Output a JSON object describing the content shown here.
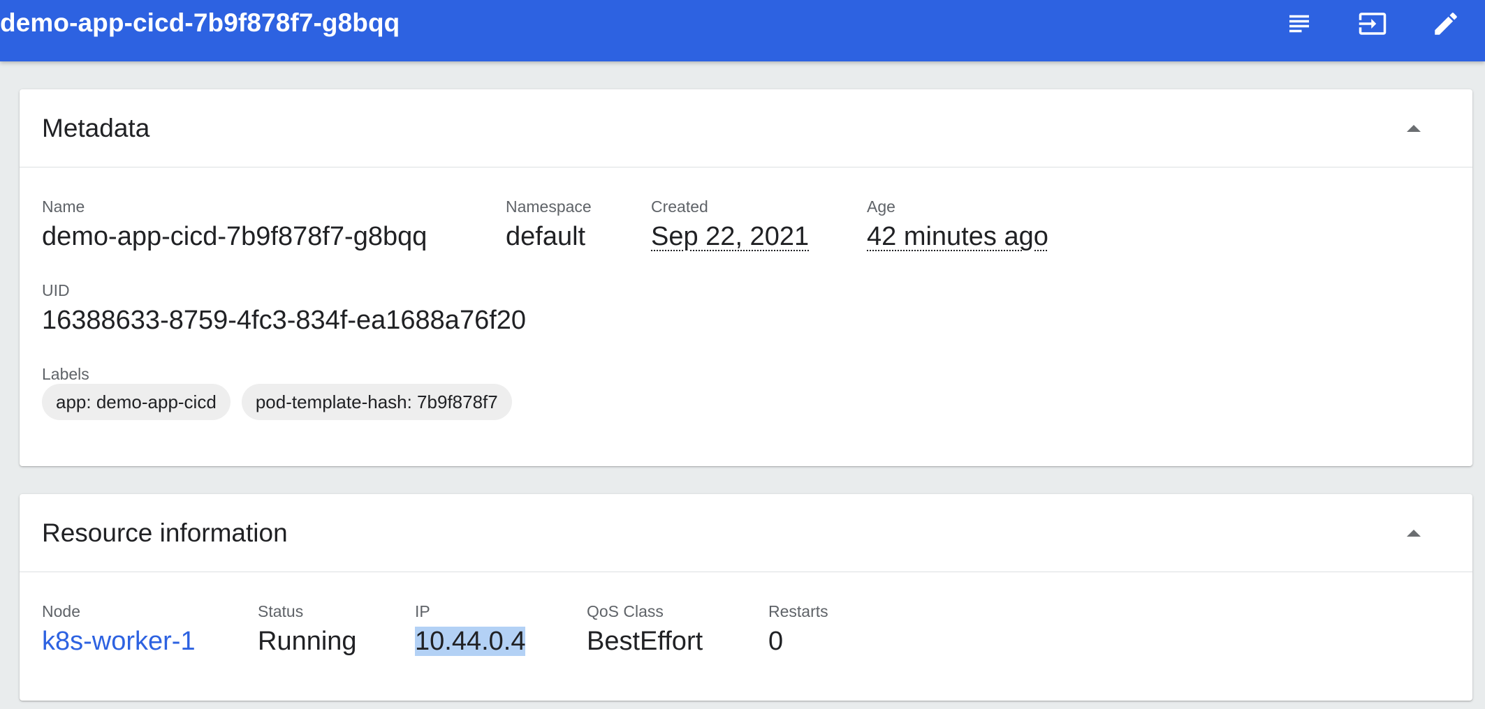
{
  "header": {
    "title": "demo-app-cicd-7b9f878f7-g8bqq",
    "actions": [
      {
        "icon": "logs-icon"
      },
      {
        "icon": "exec-icon"
      },
      {
        "icon": "edit-icon"
      },
      {
        "icon": "delete-icon"
      }
    ]
  },
  "metadata": {
    "title": "Metadata",
    "name_label": "Name",
    "name_value": "demo-app-cicd-7b9f878f7-g8bqq",
    "namespace_label": "Namespace",
    "namespace_value": "default",
    "created_label": "Created",
    "created_value": "Sep 22, 2021",
    "age_label": "Age",
    "age_value": "42 minutes ago",
    "uid_label": "UID",
    "uid_value": "16388633-8759-4fc3-834f-ea1688a76f20",
    "labels_label": "Labels",
    "labels": [
      "app: demo-app-cicd",
      "pod-template-hash: 7b9f878f7"
    ]
  },
  "resource": {
    "title": "Resource information",
    "node_label": "Node",
    "node_value": "k8s-worker-1",
    "status_label": "Status",
    "status_value": "Running",
    "ip_label": "IP",
    "ip_value": "10.44.0.4",
    "qos_label": "QoS Class",
    "qos_value": "BestEffort",
    "restarts_label": "Restarts",
    "restarts_value": "0"
  },
  "colors": {
    "toolbar": "#2d62e1",
    "background": "#e9eced",
    "link": "#2d62e1",
    "selection": "#b3d1f5"
  }
}
